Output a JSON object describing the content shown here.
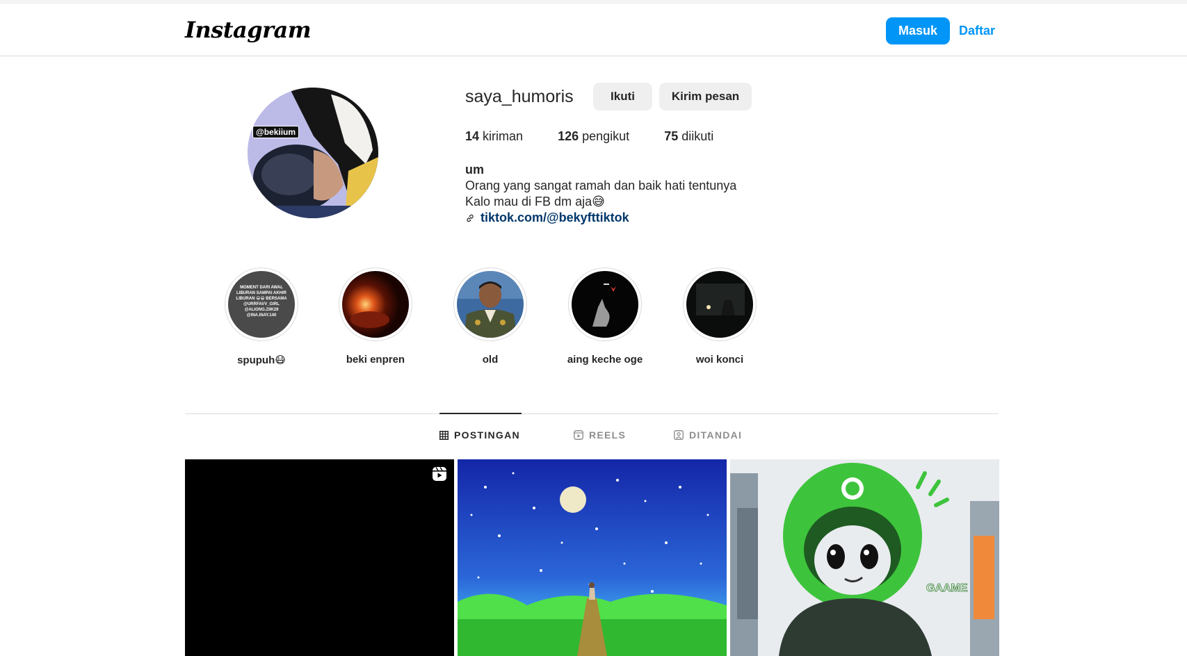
{
  "header": {
    "logo": "Instagram",
    "login_label": "Masuk",
    "signup_label": "Daftar"
  },
  "profile": {
    "avatar_tag": "@bekiium",
    "username": "saya_humoris",
    "follow_label": "Ikuti",
    "message_label": "Kirim pesan",
    "stats": {
      "posts_count": "14",
      "posts_label": "kiriman",
      "followers_count": "126",
      "followers_label": "pengikut",
      "following_count": "75",
      "following_label": "diikuti"
    },
    "bio": {
      "name": "um",
      "line1": "Orang yang sangat ramah dan baik hati tentunya",
      "line2": "Kalo mau di FB dm aja😅",
      "link": "tiktok.com/@bekyfttiktok"
    }
  },
  "highlights": [
    {
      "label": "spupuh😷",
      "image_text": "MOMENT DARI AWAL LIBURAN SAMPAI AKHIR LIBURAN 😁😁 BERSAMA @URRFAVV_GIRL @ALIONG.ZIIK29 @INA.INAY.140"
    },
    {
      "label": "beki enpren"
    },
    {
      "label": "old"
    },
    {
      "label": "aing keche oge"
    },
    {
      "label": "woi konci"
    }
  ],
  "tabs": [
    {
      "label": "POSTINGAN",
      "icon": "grid-icon",
      "active": true
    },
    {
      "label": "REELS",
      "icon": "reels-icon",
      "active": false
    },
    {
      "label": "DITANDAI",
      "icon": "tagged-icon",
      "active": false
    }
  ],
  "posts": [
    {
      "type": "reel",
      "icon": "reel-icon"
    },
    {
      "type": "image"
    },
    {
      "type": "image",
      "text": "GAAME"
    }
  ],
  "colors": {
    "accent": "#0095f6",
    "link": "#00376b",
    "text": "#262626",
    "muted": "#8e8e8e",
    "border": "#dbdbdb"
  }
}
